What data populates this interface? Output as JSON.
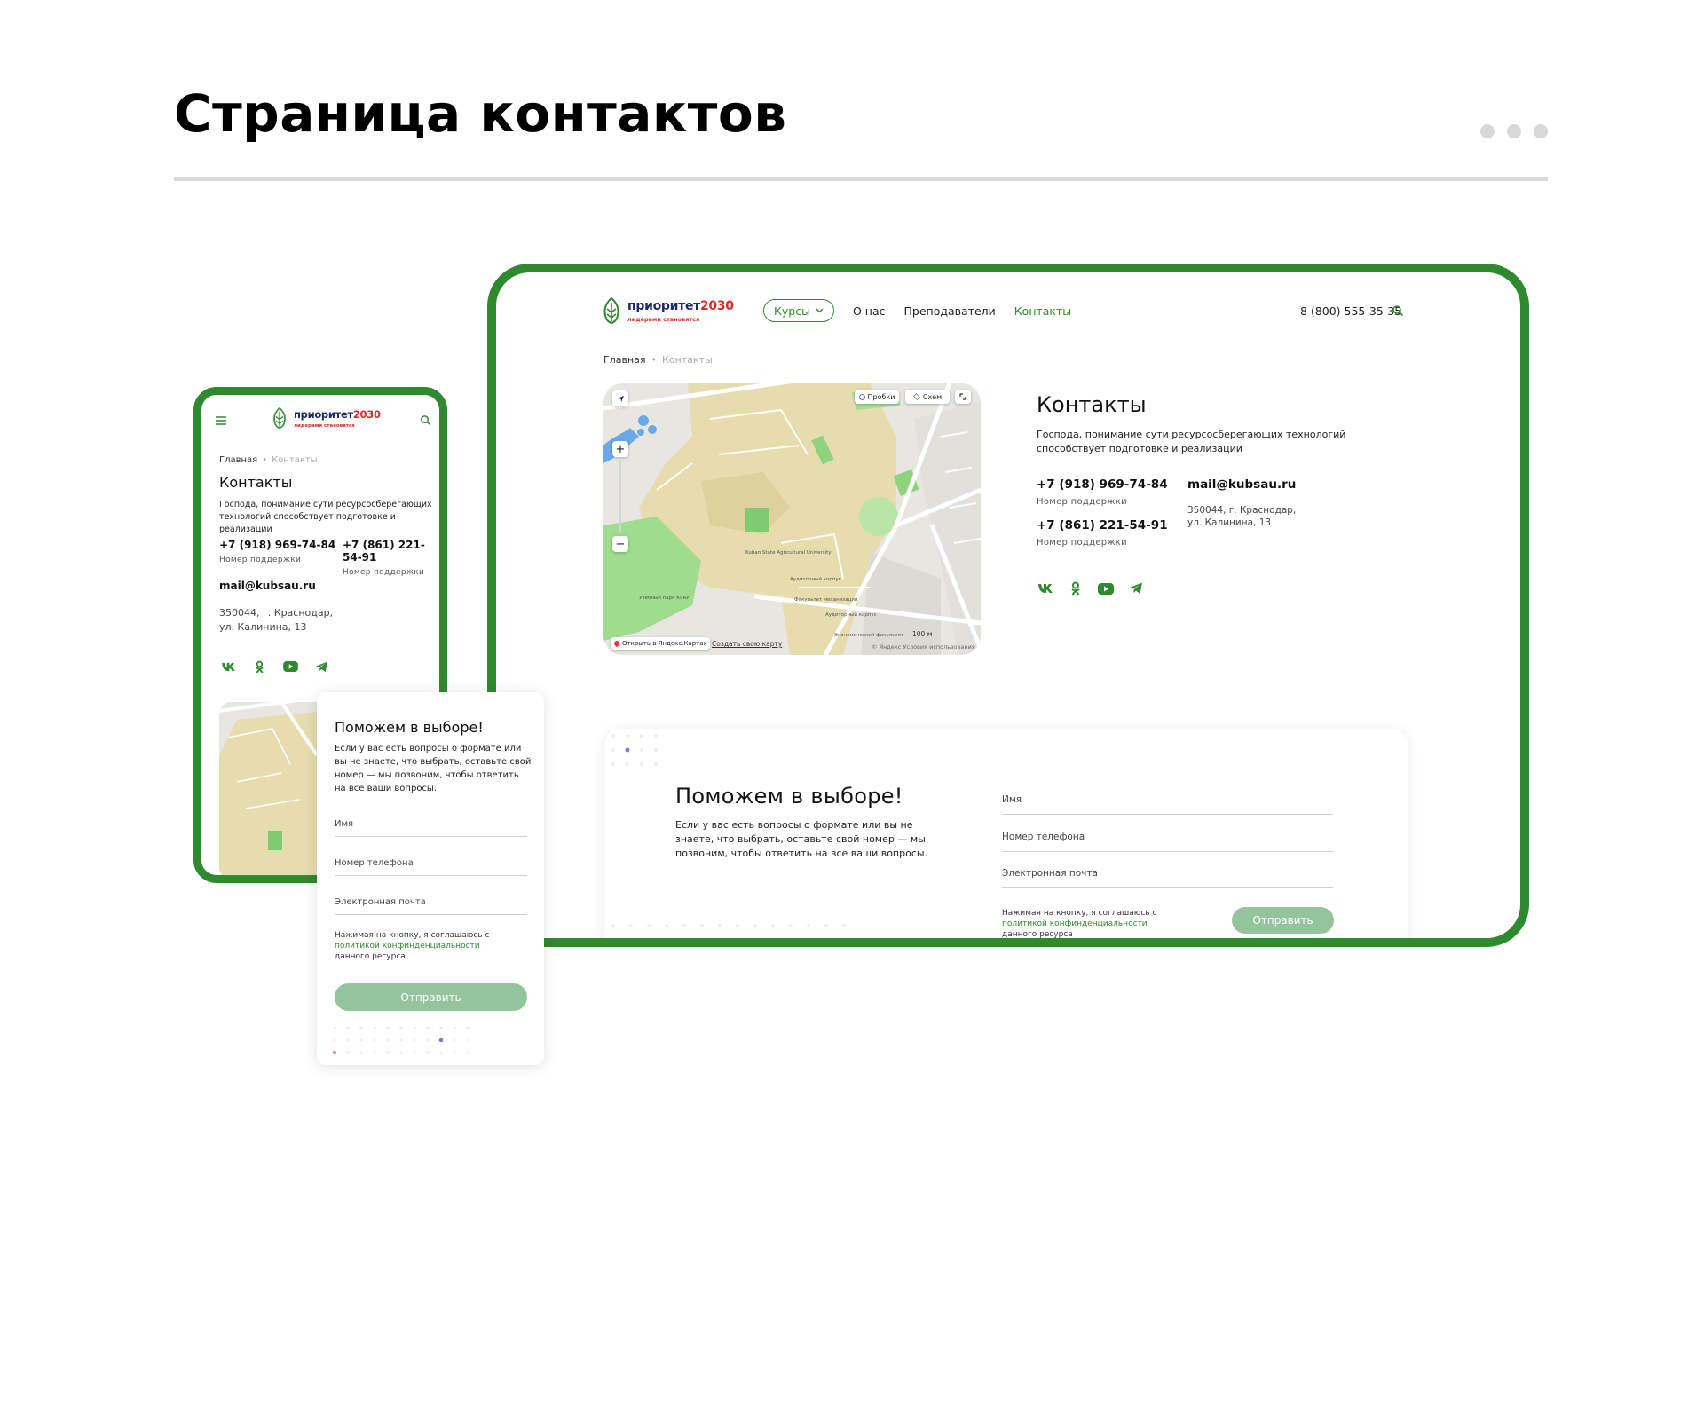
{
  "presentation": {
    "title": "Страница контактов"
  },
  "brand": {
    "name_main": "приоритет",
    "name_year": "2030",
    "tagline": "лидерами становятся",
    "accent_color": "#2f8a2f",
    "logo_blue": "#1b2a6b",
    "logo_red": "#d62b2b"
  },
  "desktop": {
    "nav": {
      "courses": "Курсы",
      "about": "О нас",
      "teachers": "Преподаватели",
      "contacts": "Контакты"
    },
    "phone": "8 (800) 555-35-35",
    "breadcrumbs": {
      "home": "Главная",
      "current": "Контакты"
    },
    "map": {
      "traffic": "Пробки",
      "layers": "Схем",
      "open_in": "Открыть в Яндекс.Картах",
      "create_map": "Создать свою карту",
      "scale": "100 м",
      "copyright": "© Яндекс  Условия использования",
      "labels": {
        "university": "Kuban State Agricultural University",
        "aud1": "Аудиторный корпус",
        "fac": "Факультет механизации",
        "aud2": "Аудиторный корпус",
        "econ": "Экономический факультет",
        "park": "Учебный парк КГАУ"
      }
    },
    "contacts": {
      "title": "Контакты",
      "lead": "Господа, понимание сути ресурсосберегающих технологий способствует подготовке и реализации",
      "phone1": "+7 (918) 969-74-84",
      "phone1_sub": "Номер поддержки",
      "phone2": "+7 (861) 221-54-91",
      "phone2_sub": "Номер поддержки",
      "email": "mail@kubsau.ru",
      "address_line1": "350044, г. Краснодар,",
      "address_line2": "ул. Калинина, 13"
    },
    "form": {
      "title": "Поможем в выборе!",
      "lead": "Если у вас есть вопросы о формате или вы не знаете, что выбрать, оставьте свой номер — мы позвоним, чтобы ответить на все ваши вопросы.",
      "name": "Имя",
      "phone": "Номер телефона",
      "email": "Электронная почта",
      "consent_1": "Нажимая на кнопку, я соглашаюсь с",
      "consent_link": "политикой конфинденциальности",
      "consent_2": "данного ресурса",
      "submit": "Отправить"
    }
  },
  "mobile": {
    "breadcrumbs": {
      "home": "Главная",
      "current": "Контакты"
    },
    "title": "Контакты",
    "lead": "Господа, понимание сути ресурсосберегающих технологий способствует подготовке и реализации",
    "phone1": "+7 (918) 969-74-84",
    "phone1_sub": "Номер поддержки",
    "phone2": "+7 (861) 221-54-91",
    "phone2_sub": "Номер поддержки",
    "email": "mail@kubsau.ru",
    "address_line1": "350044, г. Краснодар,",
    "address_line2": "ул. Калинина, 13",
    "form": {
      "title": "Поможем в выборе!",
      "lead": "Если у вас есть вопросы о формате или вы не знаете, что выбрать, оставьте свой номер — мы позвоним, чтобы ответить на все ваши вопросы.",
      "name": "Имя",
      "phone": "Номер телефона",
      "email": "Электронная почта",
      "consent_1": "Нажимая на кнопку, я соглашаюсь с",
      "consent_link": "политикой конфинденциальности",
      "consent_2": "данного ресурса",
      "submit": "Отправить"
    }
  },
  "icons": [
    "menu-icon",
    "search-icon",
    "chevron-down-icon",
    "vk-icon",
    "odnoklassniki-icon",
    "youtube-icon",
    "telegram-icon",
    "locate-icon",
    "zoom-in-icon",
    "zoom-out-icon",
    "fullscreen-icon",
    "traffic-icon",
    "layers-icon",
    "map-pin-icon",
    "leaf-logo-icon"
  ]
}
